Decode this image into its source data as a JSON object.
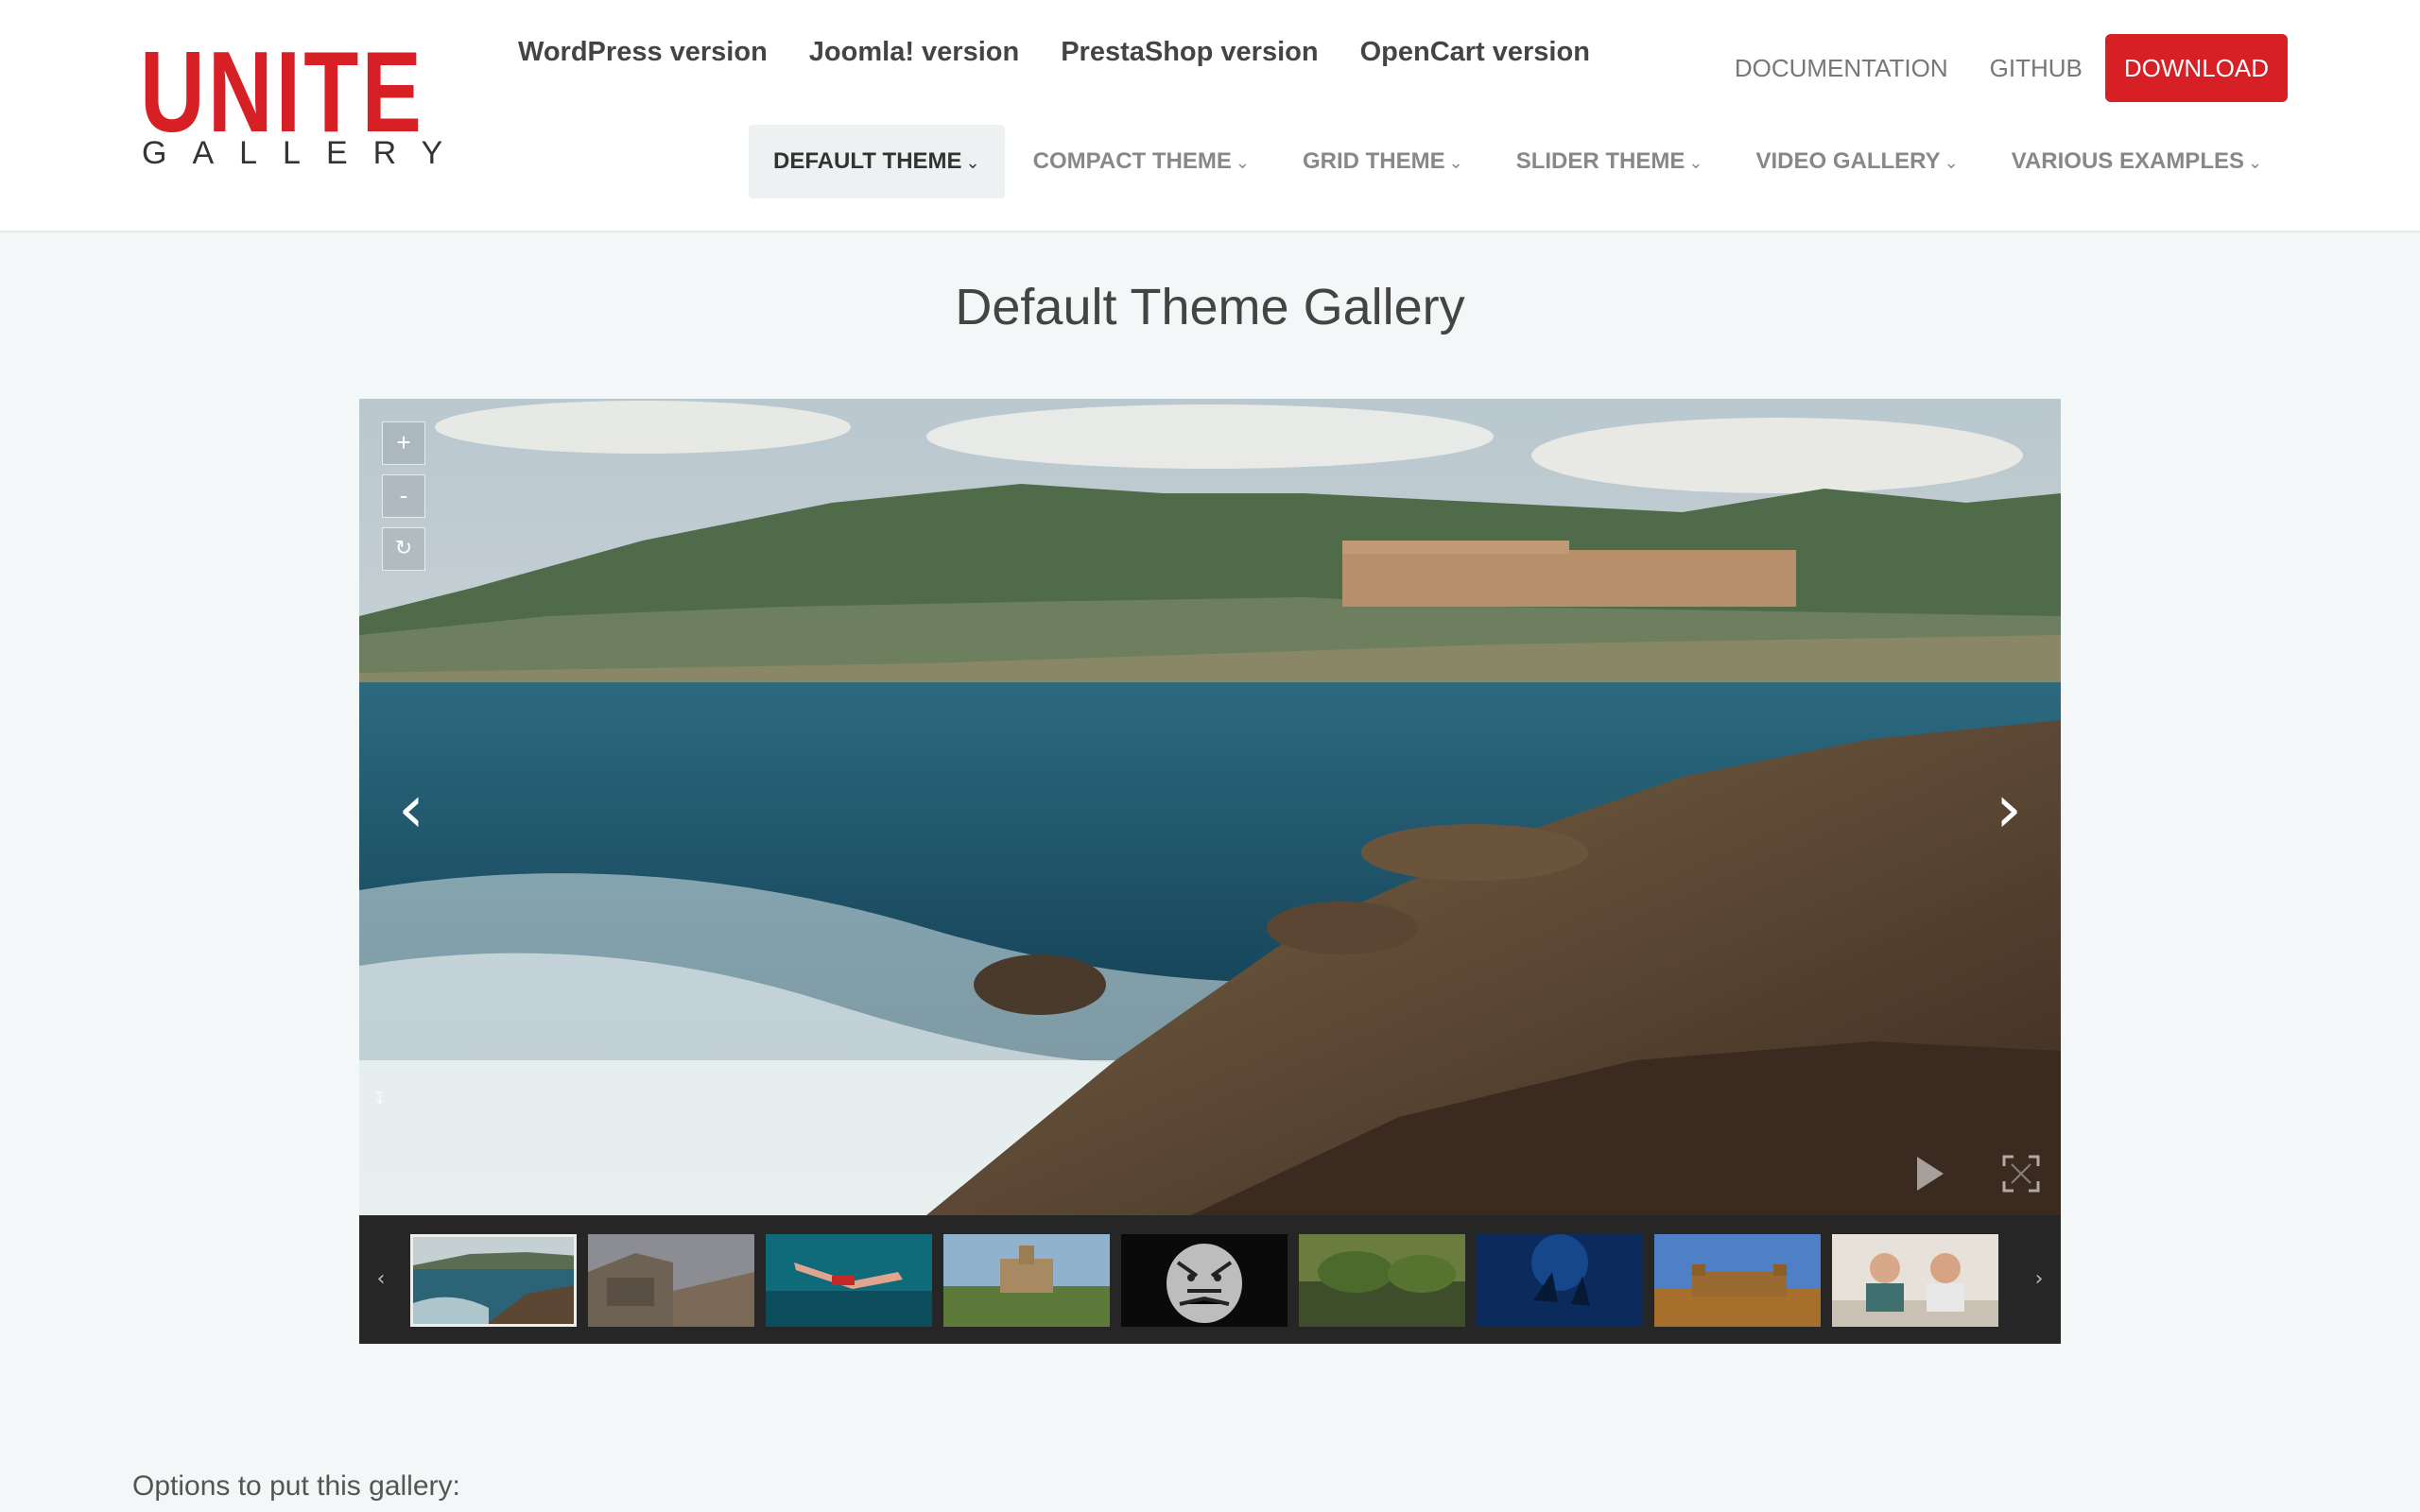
{
  "logo": {
    "word": "UNITE",
    "subword": "GALLERY"
  },
  "header": {
    "versions": [
      "WordPress version",
      "Joomla! version",
      "PrestaShop version",
      "OpenCart version"
    ],
    "documentation": "DOCUMENTATION",
    "github": "GITHUB",
    "download": "DOWNLOAD",
    "themes": [
      "DEFAULT THEME",
      "COMPACT THEME",
      "GRID THEME",
      "SLIDER THEME",
      "VIDEO GALLERY",
      "VARIOUS EXAMPLES"
    ],
    "active_theme": "DEFAULT THEME"
  },
  "page": {
    "title": "Default Theme Gallery",
    "options_text": "Options to put this gallery:"
  },
  "gallery": {
    "zoom_in": "+",
    "zoom_out": "-",
    "zoom_reset": "↻",
    "prev": "‹",
    "next": "›",
    "thumbs_prev": "‹",
    "thumbs_next": "›",
    "thumbnail_count": 9,
    "active_thumbnail": 1
  },
  "icons": {
    "zoom_in": "plus-icon",
    "zoom_out": "minus-icon",
    "zoom_reset": "reset-icon",
    "play": "play-icon",
    "fullscreen": "fullscreen-icon",
    "text_toggle": "arrow-down-icon"
  },
  "colors": {
    "brand_red": "#d71f26",
    "page_bg": "#f4f7f7",
    "gallery_bg": "#262626"
  }
}
